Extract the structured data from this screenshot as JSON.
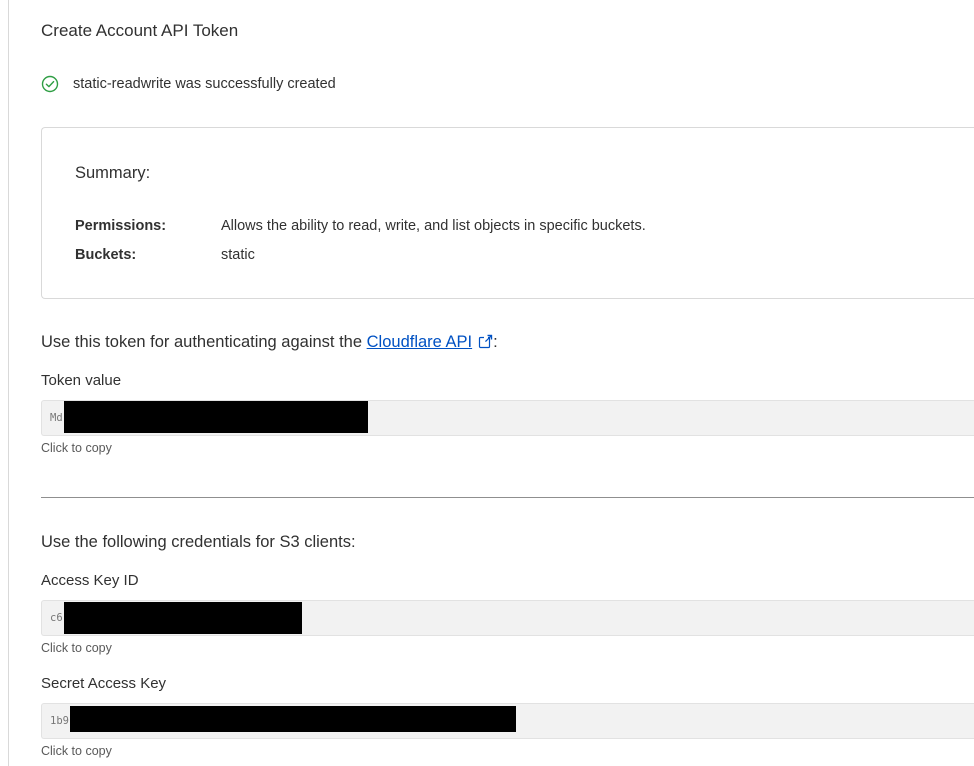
{
  "header": {
    "title": "Create Account API Token"
  },
  "status": {
    "icon": "check-circle-icon",
    "color": "#2f9e44",
    "message": "static-readwrite was successfully created"
  },
  "summary": {
    "title": "Summary:",
    "permissions_label": "Permissions:",
    "permissions_value": "Allows the ability to read, write, and list objects in specific buckets.",
    "buckets_label": "Buckets:",
    "buckets_value": "static"
  },
  "token_section": {
    "intro_prefix": "Use this token for authenticating against the",
    "link_text": "Cloudflare API",
    "link_icon": "external-link-icon",
    "intro_suffix": ":",
    "link_color": "#0051c3",
    "label": "Token value",
    "value_prefix": "Md",
    "copy_hint": "Click to copy"
  },
  "s3_section": {
    "intro": "Use the following credentials for S3 clients:",
    "access_key": {
      "label": "Access Key ID",
      "value_prefix": "c6",
      "copy_hint": "Click to copy"
    },
    "secret_key": {
      "label": "Secret Access Key",
      "value_prefix": "1b9",
      "copy_hint": "Click to copy"
    }
  }
}
